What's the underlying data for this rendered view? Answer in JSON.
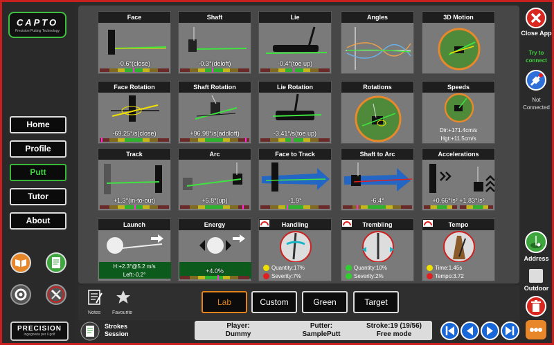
{
  "sidebar": {
    "logo_brand": "CAPTO",
    "logo_tagline": "Precision Putting Technology",
    "nav": [
      {
        "label": "Home"
      },
      {
        "label": "Profile"
      },
      {
        "label": "Putt"
      },
      {
        "label": "Tutor"
      },
      {
        "label": "About"
      }
    ],
    "active_nav": "Putt",
    "icons": [
      "book-icon",
      "notepad-icon",
      "gear-icon",
      "tools-icon"
    ],
    "footer_brand": "PRECISION",
    "footer_tagline": "ingegneria per il golf"
  },
  "tiles": [
    {
      "title": "Face",
      "value": "-0.6°(close)"
    },
    {
      "title": "Shaft",
      "value": "-0.3°(deloft)"
    },
    {
      "title": "Lie",
      "value": "-0.4°(toe up)"
    },
    {
      "title": "Angles",
      "value": ""
    },
    {
      "title": "3D Motion",
      "value": ""
    },
    {
      "title": "Face Rotation",
      "value": "-69.25°/s(close)"
    },
    {
      "title": "Shaft Rotation",
      "value": "+96.98°/s(addloft)"
    },
    {
      "title": "Lie Rotation",
      "value": "-3.41°/s(toe up)"
    },
    {
      "title": "Rotations",
      "value": ""
    },
    {
      "title": "Speeds",
      "lines": [
        "Dir:+171.4cm/s",
        "Hgt:+11.5cm/s"
      ]
    },
    {
      "title": "Track",
      "value": "+1.3°(in-to-out)"
    },
    {
      "title": "Arc",
      "value": "+5.8°(up)"
    },
    {
      "title": "Face to Track",
      "value": "-1.9°"
    },
    {
      "title": "Shaft to Arc",
      "value": "-6.4°"
    },
    {
      "title": "Accelerations",
      "value": "+0.66°/s²    +1.83°/s²"
    },
    {
      "title": "Launch",
      "lines": [
        "H:+2.3°@5.2 m/s",
        "Left:-0.2°"
      ]
    },
    {
      "title": "Energy",
      "value": "+4.0%"
    },
    {
      "title": "Handling",
      "lines": [
        "Quantity:17%",
        "Severity:7%"
      ]
    },
    {
      "title": "Trembling",
      "lines": [
        "Quantity:10%",
        "Severity:2%"
      ]
    },
    {
      "title": "Tempo",
      "lines": [
        "Time:1.45s",
        "Tempo:3.72"
      ]
    }
  ],
  "bottom": {
    "notes_label": "Notes",
    "favourite_label": "Favourite",
    "tabs": [
      "Lab",
      "Custom",
      "Green",
      "Target"
    ],
    "active_tab": "Lab",
    "strokes_label": "Strokes",
    "session_label": "Session"
  },
  "status": {
    "player_label": "Player:",
    "player_value": "Dummy",
    "putter_label": "Putter:",
    "putter_value": "SamplePutt",
    "stroke_label": "Stroke:19 (19/56)",
    "mode_label": "Free mode"
  },
  "rightbar": {
    "close_label": "Close App",
    "try_label": "Try to connect",
    "connection_label": "Not Connected",
    "address_label": "Address",
    "outdoor_label": "Outdoor"
  },
  "colors": {
    "frame": "#c8201e",
    "accent_green": "#37b837",
    "accent_orange": "#e3831b",
    "nav_blue": "#1767d8"
  }
}
